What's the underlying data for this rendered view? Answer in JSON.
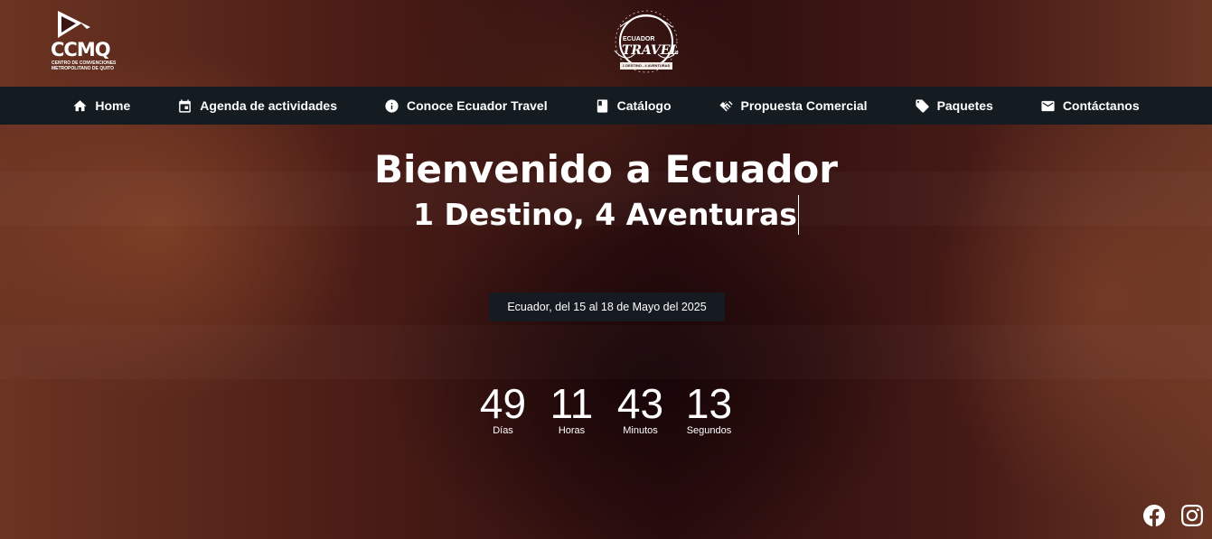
{
  "header": {
    "ccmq_logo": {
      "text": "CCMQ",
      "subtext": "CENTRO DE CONVENCIONES METROPOLITANO DE QUITO"
    },
    "ecuador_travel_logo": {
      "line1": "ECUADOR",
      "line2": "TRAVEL",
      "tagline": "1 DESTINO - 4 AVENTURAS"
    }
  },
  "nav": {
    "items": [
      {
        "label": "Home",
        "icon": "home-icon"
      },
      {
        "label": "Agenda de actividades",
        "icon": "calendar-icon"
      },
      {
        "label": "Conoce Ecuador Travel",
        "icon": "info-icon"
      },
      {
        "label": "Catálogo",
        "icon": "book-icon"
      },
      {
        "label": "Propuesta Comercial",
        "icon": "handshake-icon"
      },
      {
        "label": "Paquetes",
        "icon": "tag-icon"
      },
      {
        "label": "Contáctanos",
        "icon": "mail-icon"
      }
    ]
  },
  "hero": {
    "title": "Bienvenido a Ecuador",
    "subtitle": "1 Destino, 4 Aventuras",
    "date_text": "Ecuador, del 15 al 18 de Mayo del 2025"
  },
  "countdown": {
    "units": [
      {
        "value": "49",
        "label": "Días"
      },
      {
        "value": "11",
        "label": "Horas"
      },
      {
        "value": "43",
        "label": "Minutos"
      },
      {
        "value": "13",
        "label": "Segundos"
      }
    ]
  },
  "social": {
    "icons": [
      "facebook-icon",
      "instagram-icon"
    ]
  }
}
